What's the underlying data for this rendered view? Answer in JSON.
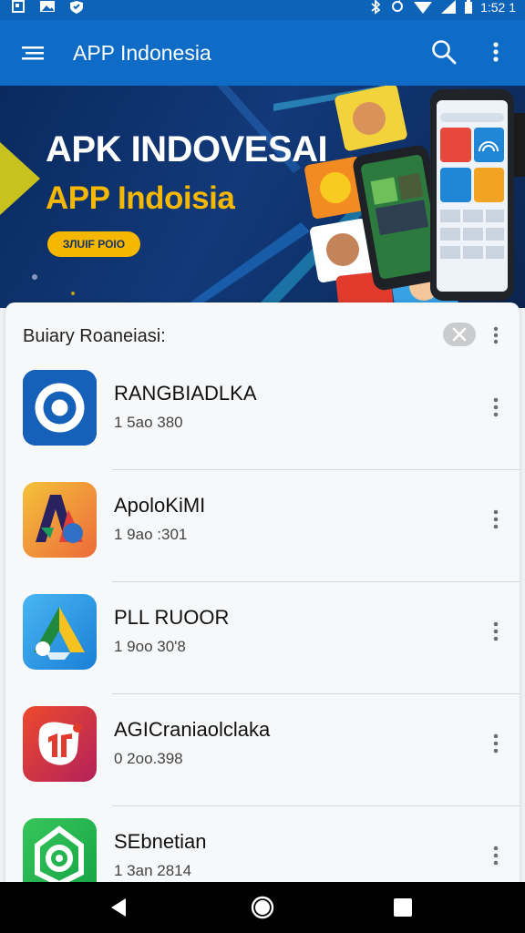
{
  "status_bar": {
    "time": "1:52 1",
    "left_icons": [
      "notification-icon",
      "image-icon",
      "shield-icon"
    ],
    "right_icons": [
      "bluetooth-icon",
      "sync-icon",
      "wifi-icon",
      "signal-icon",
      "battery-icon"
    ]
  },
  "app_bar": {
    "title": "APP Indonesia",
    "icons": [
      "menu-icon",
      "search-icon",
      "more-vert-icon"
    ]
  },
  "banner": {
    "title": "APK INDOVESAI",
    "subtitle": "APP Indoisia",
    "cta": "ЗЛUIF РОIO"
  },
  "list": {
    "title": "Buiary Roaneiasi:",
    "items": [
      {
        "name": "RANGBIADLKA",
        "meta": "1 5ao 380",
        "icon": "target-app-icon",
        "colors": [
          "#0e4fa3",
          "#1f70cc"
        ]
      },
      {
        "name": "ApoloKiMI",
        "meta": "1 9ao :301",
        "icon": "aa-app-icon",
        "colors": [
          "#f2b233",
          "#ec6a3a"
        ]
      },
      {
        "name": "PLL RUOOR",
        "meta": "1 9oo 30'8",
        "icon": "triangle-app-icon",
        "colors": [
          "#1d8de0",
          "#4cb3f0"
        ]
      },
      {
        "name": "AGICraniaolclaka",
        "meta": "0 2oo.398",
        "icon": "sticker-app-icon",
        "colors": [
          "#e23b2e",
          "#b72454"
        ]
      },
      {
        "name": "SEbnetian",
        "meta": "1 3an 2814",
        "icon": "spiral-app-icon",
        "colors": [
          "#19b04b",
          "#37c95d"
        ]
      }
    ]
  },
  "nav_bar": {
    "icons": [
      "back-icon",
      "home-icon",
      "recents-icon"
    ]
  },
  "colors": {
    "app_bar": "#0e6cc7",
    "status_bar": "#0d63b8",
    "accent": "#f5b800",
    "banner_bg": "#0b2a5c"
  }
}
